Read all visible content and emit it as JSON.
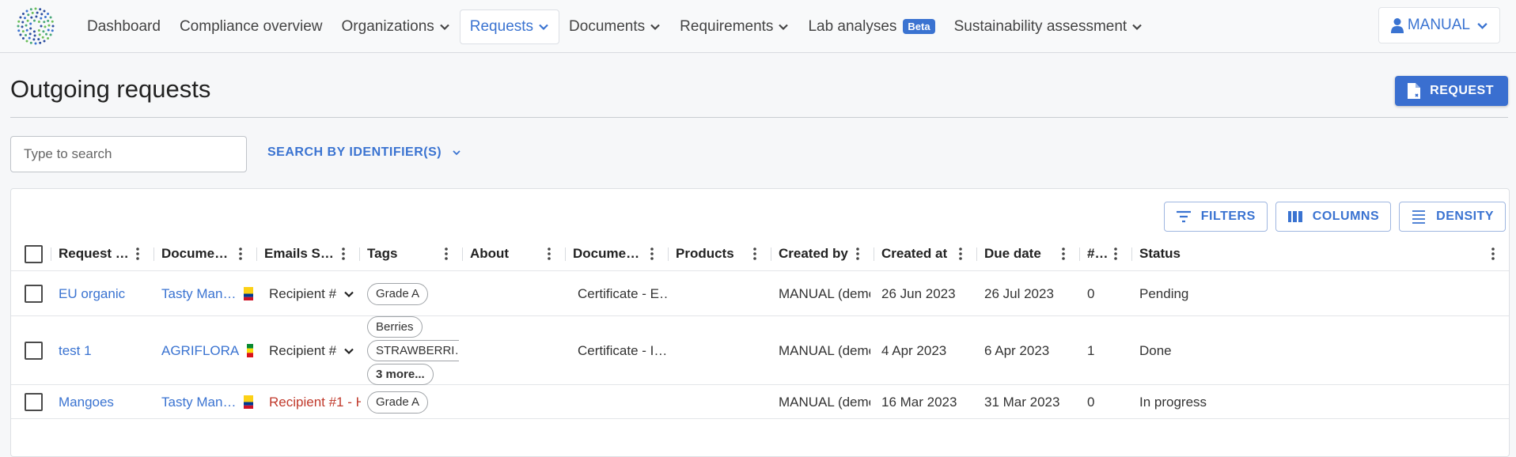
{
  "nav": {
    "items": [
      {
        "label": "Dashboard",
        "has_chevron": false
      },
      {
        "label": "Compliance overview",
        "has_chevron": false
      },
      {
        "label": "Organizations",
        "has_chevron": true
      },
      {
        "label": "Requests",
        "has_chevron": true,
        "active": true
      },
      {
        "label": "Documents",
        "has_chevron": true
      },
      {
        "label": "Requirements",
        "has_chevron": true
      },
      {
        "label": "Lab analyses",
        "has_chevron": false,
        "badge": "Beta"
      },
      {
        "label": "Sustainability assessment",
        "has_chevron": true
      }
    ],
    "user_label": "MANUAL",
    "user_icon": "person-icon"
  },
  "page": {
    "title": "Outgoing requests",
    "request_button": "REQUEST"
  },
  "search": {
    "placeholder": "Type to search",
    "identifier_label": "SEARCH BY IDENTIFIER(S)"
  },
  "toolbar": {
    "filters": "FILTERS",
    "columns": "COLUMNS",
    "density": "DENSITY"
  },
  "table": {
    "columns": [
      "Request title",
      "Document p…",
      "Emails Stat…",
      "Tags",
      "About",
      "Document T…",
      "Products",
      "Created by",
      "Created at",
      "Due date",
      "# …",
      "Status"
    ],
    "rows": [
      {
        "title": "EU organic",
        "document_provider": "Tasty Man…",
        "flag": "colombia",
        "email_status": "Recipient #",
        "email_style": "select",
        "tags": [
          "Grade A"
        ],
        "more_tags": "",
        "about": "",
        "document_type": "Certificate - E…",
        "products": "",
        "created_by": "MANUAL (demoag",
        "created_at": "26 Jun 2023",
        "due_date": "26 Jul 2023",
        "count": "0",
        "status": "Pending"
      },
      {
        "title": "test 1",
        "document_provider": "AGRIFLORA",
        "flag": "ethiopia",
        "email_status": "Recipient #",
        "email_style": "select",
        "tags": [
          "Berries",
          "STRAWBERRI…"
        ],
        "more_tags": "3 more...",
        "about": "",
        "document_type": "Certificate - I…",
        "products": "",
        "created_by": "MANUAL (demoag",
        "created_at": "4 Apr 2023",
        "due_date": "6 Apr 2023",
        "count": "1",
        "status": "Done"
      },
      {
        "title": "Mangoes",
        "document_provider": "Tasty Man…",
        "flag": "colombia",
        "email_status": "Recipient #1 - H",
        "email_style": "error",
        "tags": [
          "Grade A"
        ],
        "more_tags": "",
        "about": "",
        "document_type": "",
        "products": "",
        "created_by": "MANUAL (demoag",
        "created_at": "16 Mar 2023",
        "due_date": "31 Mar 2023",
        "count": "0",
        "status": "In progress"
      }
    ]
  },
  "colors": {
    "accent": "#3a73d1",
    "error": "#c0392b"
  }
}
